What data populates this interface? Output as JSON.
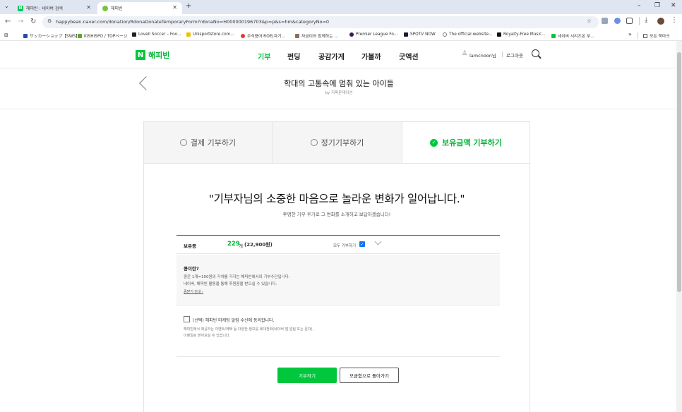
{
  "browser": {
    "tabs": [
      {
        "title": "해피빈 : 네이버 검색",
        "active": false
      },
      {
        "title": "해피빈",
        "active": true
      }
    ],
    "new_tab": "+",
    "window_controls": {
      "minimize": "–",
      "restore": "❐",
      "close": "✕"
    },
    "url": "happybean.naver.com/donation/RdonaDonateTemporaryForm?rdonaNo=H000000196703&p=p&s=hm&categoryNo=0",
    "bookmarks": [
      "サッカーショップ【SWS】...",
      "KISHISPO / TOPページ",
      "Lovell Soccer – Foo...",
      "Unisportstore.com...",
      "주식용어 ROE(자기...",
      "자금이와 함께하는 ...",
      "Premier League Fo...",
      "SPOTV NOW",
      "The official website...",
      "Royalty-Free Music...",
      "네이버 시리즈온 무..."
    ],
    "bookmarks_more": "»",
    "all_bookmarks": "모든 북마크"
  },
  "site": {
    "logo_letter": "N",
    "logo_text": "해피빈",
    "nav": [
      "기부",
      "펀딩",
      "공감가게",
      "가볼까",
      "굿액션"
    ],
    "user_name": "lamcnoon님",
    "logout": "로그아웃"
  },
  "campaign": {
    "title": "학대의 고통속에 멈춰 있는 아이들",
    "org": "by 지파운데이션"
  },
  "donate_tabs": [
    {
      "label": "결제 기부하기",
      "selected": false
    },
    {
      "label": "정기기부하기",
      "selected": false
    },
    {
      "label": "보유금액 기부하기",
      "selected": true
    }
  ],
  "main": {
    "headline": "\"기부자님의 소중한 마음으로 놀라운 변화가 일어납니다.\"",
    "subtext": "투명한 기부 후기로 그 변화를 소개하고 보답하겠습니다!",
    "bean_label": "보유콩",
    "bean_count": "229",
    "bean_unit": "개",
    "bean_amount": "(22,900원)",
    "donate_all": "모두 기부하기",
    "donate_all_checked": true,
    "info_title": "콩이란?",
    "info_line1": "콩은 1개=100원의 가치를 가지는 해피빈에서의 기부수단입니다.",
    "info_line2": "네이버, 해피빈 활동을 통해 후원콩을 받으실 수 있습니다.",
    "info_link": "콩받기 안내 ›",
    "consent_label": "(선택) 해피빈 마케팅 알림 수신에 동의합니다.",
    "consent_desc1": "해피빈에서 제공하는 이벤트/혜택 등 다양한 정보를 휴대전화(네이버 앱 알림 또는 문자),",
    "consent_desc2": "이메일로 받아보실 수 있습니다.",
    "donate_button": "기부하기",
    "back_button": "모금함으로 돌아가기"
  },
  "colors": {
    "brand_green": "#00c73c",
    "tabstrip": "#dfe6f1",
    "omnibox": "#eef1f7"
  }
}
